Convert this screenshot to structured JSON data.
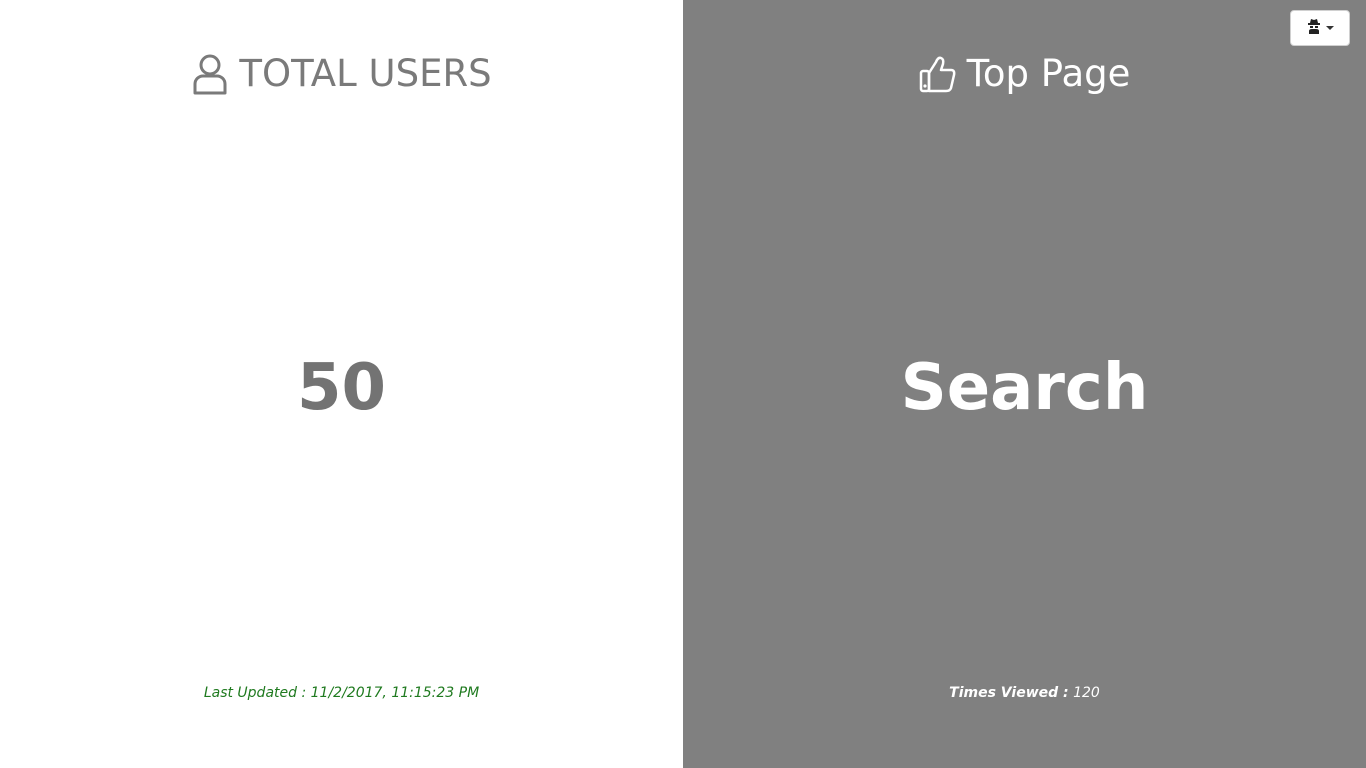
{
  "left_panel": {
    "title": "TOTAL USERS",
    "title_icon": "user-icon",
    "value": "50",
    "footer_text": "Last Updated : 11/2/2017, 11:15:23 PM",
    "background": "#ffffff",
    "text_color": "#7a7a7a",
    "footer_color": "#1f7a1f"
  },
  "right_panel": {
    "title": "Top Page",
    "title_icon": "thumbs-up-icon",
    "value": "Search",
    "footer_label": "Times Viewed :",
    "footer_value": "120",
    "background": "#808080",
    "text_color": "#ffffff"
  },
  "menu_button": {
    "icon": "spy-icon",
    "dropdown_icon": "caret-down-icon"
  }
}
